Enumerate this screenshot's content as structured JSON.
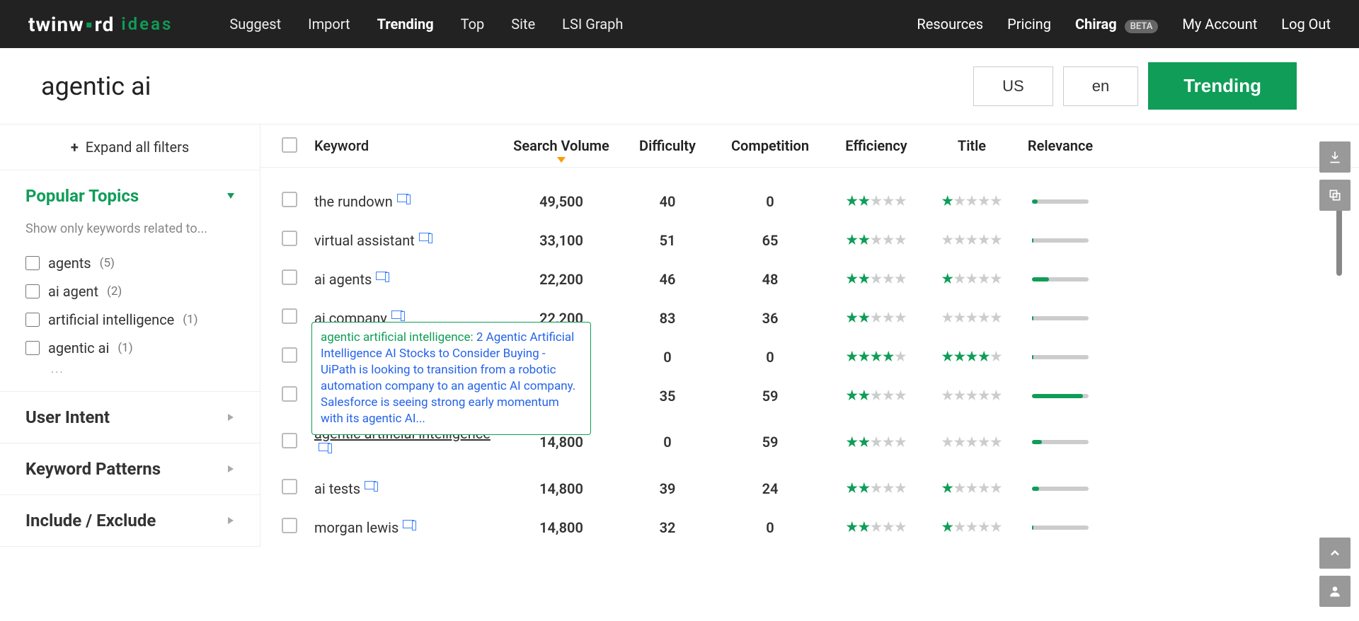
{
  "brand": {
    "part1": "twinw",
    "dot": "●",
    "part2": "rd",
    "part3": "ideas"
  },
  "nav": {
    "main": [
      {
        "label": "Suggest",
        "active": false
      },
      {
        "label": "Import",
        "active": false
      },
      {
        "label": "Trending",
        "active": true
      },
      {
        "label": "Top",
        "active": false
      },
      {
        "label": "Site",
        "active": false
      },
      {
        "label": "LSI Graph",
        "active": false
      }
    ],
    "right": {
      "resources": "Resources",
      "pricing": "Pricing",
      "username": "Chirag",
      "beta": "BETA",
      "account": "My Account",
      "logout": "Log Out"
    }
  },
  "search": {
    "query": "agentic ai",
    "region": "US",
    "language": "en",
    "action": "Trending"
  },
  "sidebar": {
    "expand_label": "Expand all filters",
    "popular": {
      "title": "Popular Topics",
      "hint": "Show only keywords related to...",
      "items": [
        {
          "label": "agents",
          "count": "(5)"
        },
        {
          "label": "ai agent",
          "count": "(2)"
        },
        {
          "label": "artificial intelligence",
          "count": "(1)"
        },
        {
          "label": "agentic ai",
          "count": "(1)"
        }
      ],
      "more": "..."
    },
    "user_intent": {
      "title": "User Intent"
    },
    "keyword_patterns": {
      "title": "Keyword Patterns"
    },
    "include_exclude": {
      "title": "Include / Exclude"
    }
  },
  "table": {
    "headers": {
      "keyword": "Keyword",
      "search_volume": "Search Volume",
      "difficulty": "Difficulty",
      "competition": "Competition",
      "efficiency": "Efficiency",
      "title": "Title",
      "relevance": "Relevance"
    },
    "rows": [
      {
        "keyword": "the rundown",
        "volume": "49,500",
        "difficulty": "40",
        "competition": "0",
        "eff": 2,
        "title": 1,
        "rel": 10
      },
      {
        "keyword": "virtual assistant",
        "volume": "33,100",
        "difficulty": "51",
        "competition": "65",
        "eff": 2,
        "title": 0,
        "rel": 2
      },
      {
        "keyword": "ai agents",
        "volume": "22,200",
        "difficulty": "46",
        "competition": "48",
        "eff": 2,
        "title": 1,
        "rel": 30
      },
      {
        "keyword": "ai company",
        "volume": "22,200",
        "difficulty": "83",
        "competition": "36",
        "eff": 2,
        "title": 0,
        "rel": 2
      },
      {
        "keyword": "",
        "volume": "",
        "difficulty": "0",
        "competition": "0",
        "eff": 4,
        "title": 4,
        "rel": 2
      },
      {
        "keyword": "",
        "volume": "",
        "difficulty": "35",
        "competition": "59",
        "eff": 2,
        "title": 0,
        "rel": 90
      },
      {
        "keyword": "agentic artificial intelligence",
        "volume": "14,800",
        "difficulty": "0",
        "competition": "59",
        "eff": 2,
        "title": 0,
        "rel": 18,
        "link": true
      },
      {
        "keyword": "ai tests",
        "volume": "14,800",
        "difficulty": "39",
        "competition": "24",
        "eff": 2,
        "title": 1,
        "rel": 12
      },
      {
        "keyword": "morgan lewis",
        "volume": "14,800",
        "difficulty": "32",
        "competition": "0",
        "eff": 2,
        "title": 1,
        "rel": 2
      }
    ]
  },
  "tooltip": {
    "title": "agentic artificial intelligence: ",
    "body": "2 Agentic Artificial Intelligence AI Stocks to Consider Buying - UiPath is looking to transition from a robotic automation company to an agentic AI company. Salesforce is seeing strong early momentum with its agentic AI..."
  }
}
